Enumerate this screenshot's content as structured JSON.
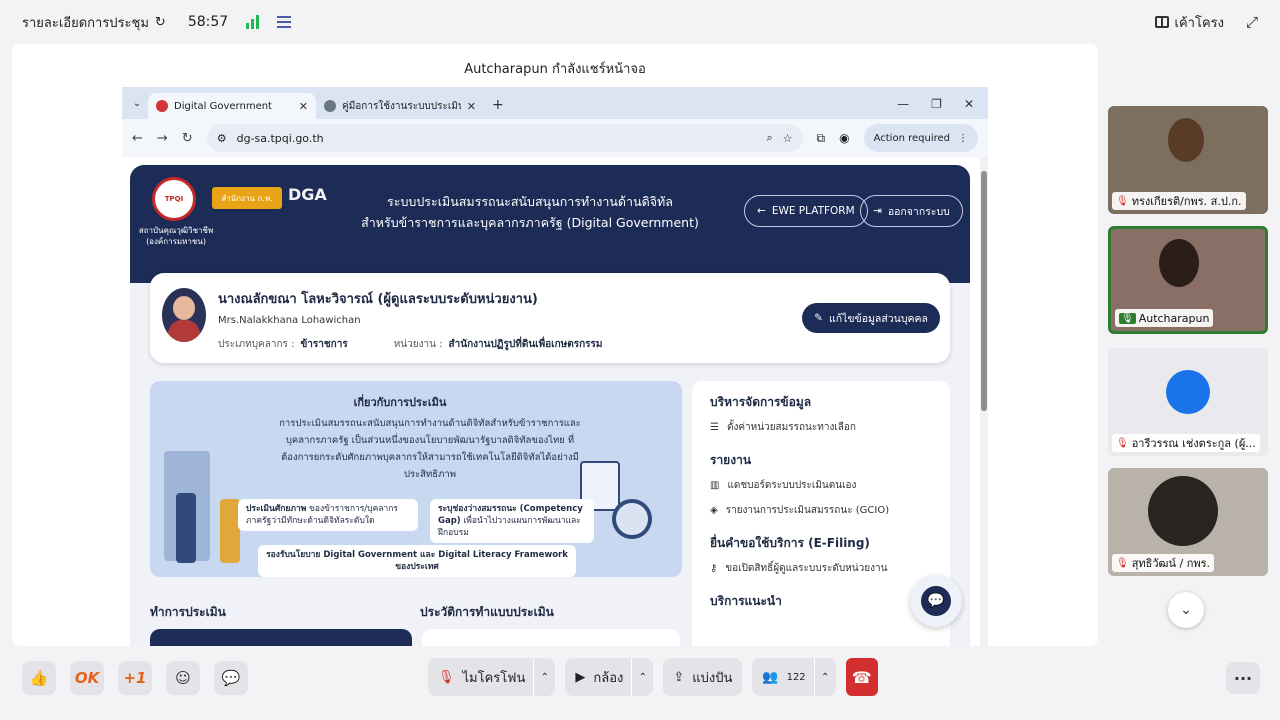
{
  "topbar": {
    "meeting_details": "รายละเอียดการประชุม",
    "timer": "58:57",
    "layout_label": "เค้าโครง"
  },
  "stage": {
    "share_label": "Autcharapun กำลังแชร์หน้าจอ"
  },
  "browser": {
    "tabs": [
      {
        "title": "Digital Government"
      },
      {
        "title": "คู่มือการใช้งานระบบประเมินเกษตรด้าน"
      }
    ],
    "url": "dg-sa.tpqi.go.th",
    "action_required": "Action required"
  },
  "site": {
    "logo_caption": "สถาบันคุณวุฒิวิชาชีพ (องค์การมหาชน)",
    "logo2_text": "สำนักงาน ก.พ.",
    "logo3_text": "DGA",
    "title_line1": "ระบบประเมินสมรรถนะสนับสนุนการทำงานด้านดิจิทัล",
    "title_line2": "สำหรับข้าราชการและบุคลากรภาครัฐ (Digital Government)",
    "ewe_button": "EWE PLATFORM",
    "logout_button": "ออกจากระบบ",
    "profile": {
      "name_th": "นางณลักขณา โลหะวิจารณ์ (ผู้ดูแลระบบระดับหน่วยงาน)",
      "name_en": "Mrs.Nalakkhana Lohawichan",
      "type_label": "ประเภทบุคลากร :",
      "type_value": "ข้าราชการ",
      "org_label": "หน่วยงาน :",
      "org_value": "สำนักงานปฏิรูปที่ดินเพื่อเกษตรกรรม",
      "edit_button": "แก้ไขข้อมูลส่วนบุคคล"
    },
    "about": {
      "heading": "เกี่ยวกับการประเมิน",
      "body": "การประเมินสมรรถนะสนับสนุนการทำงานด้านดิจิทัลสำหรับข้าราชการและบุคลากรภาครัฐ เป็นส่วนหนึ่งของนโยบายพัฒนารัฐบาลดิจิทัลของไทย ที่ต้องการยกระดับศักยภาพบุคลากรให้สามารถใช้เทคโนโลยีดิจิทัลได้อย่างมีประสิทธิภาพ",
      "pill1_bold": "ประเมินศักยภาพ",
      "pill1_rest": "ของข้าราชการ/บุคลากรภาครัฐว่ามีทักษะด้านดิจิทัลระดับใด",
      "pill2_bold": "ระบุช่องว่างสมรรถนะ (Competency Gap)",
      "pill2_rest": "เพื่อนำไปวางแผนการพัฒนาและฝึกอบรม",
      "pill3": "รองรับนโยบาย Digital Government และ Digital Literacy Framework ของประเทศ"
    },
    "panel": {
      "sec1": "บริหารจัดการข้อมูล",
      "sec1_item1": "ตั้งค่าหน่วยสมรรถนะทางเลือก",
      "sec2": "รายงาน",
      "sec2_item1": "แดชบอร์ดระบบประเมินตนเอง",
      "sec2_item2": "รายงานการประเมินสมรรถนะ (GCIO)",
      "sec3": "ยื่นคำขอใช้บริการ (E-Filing)",
      "sec3_item1": "ขอเปิดสิทธิ์ผู้ดูแลระบบระดับหน่วยงาน",
      "sec4": "บริการแนะนำ"
    },
    "section_assess": "ทำการประเมิน",
    "section_history": "ประวัติการทำแบบประเมิน"
  },
  "participants": [
    {
      "name": "ทรงเกียรติ/กพร. ส.ป.ก.",
      "muted": true
    },
    {
      "name": "Autcharapun",
      "muted": false
    },
    {
      "name": "อารีวรรณ เช่งตระกูล (ผู้...",
      "muted": true
    },
    {
      "name": "สุทธิวัฒน์ / กพร.",
      "muted": true
    }
  ],
  "bottombar": {
    "ok_label": "OK",
    "plus_label": "+1",
    "mic_label": "ไมโครโฟน",
    "camera_label": "กล้อง",
    "share_label": "แบ่งปัน",
    "people_count": "122"
  },
  "colors": {
    "navy": "#1c2c57",
    "end_call": "#d32f2f",
    "active_speaker": "#2e7d32",
    "accent_orange": "#e8611a"
  }
}
